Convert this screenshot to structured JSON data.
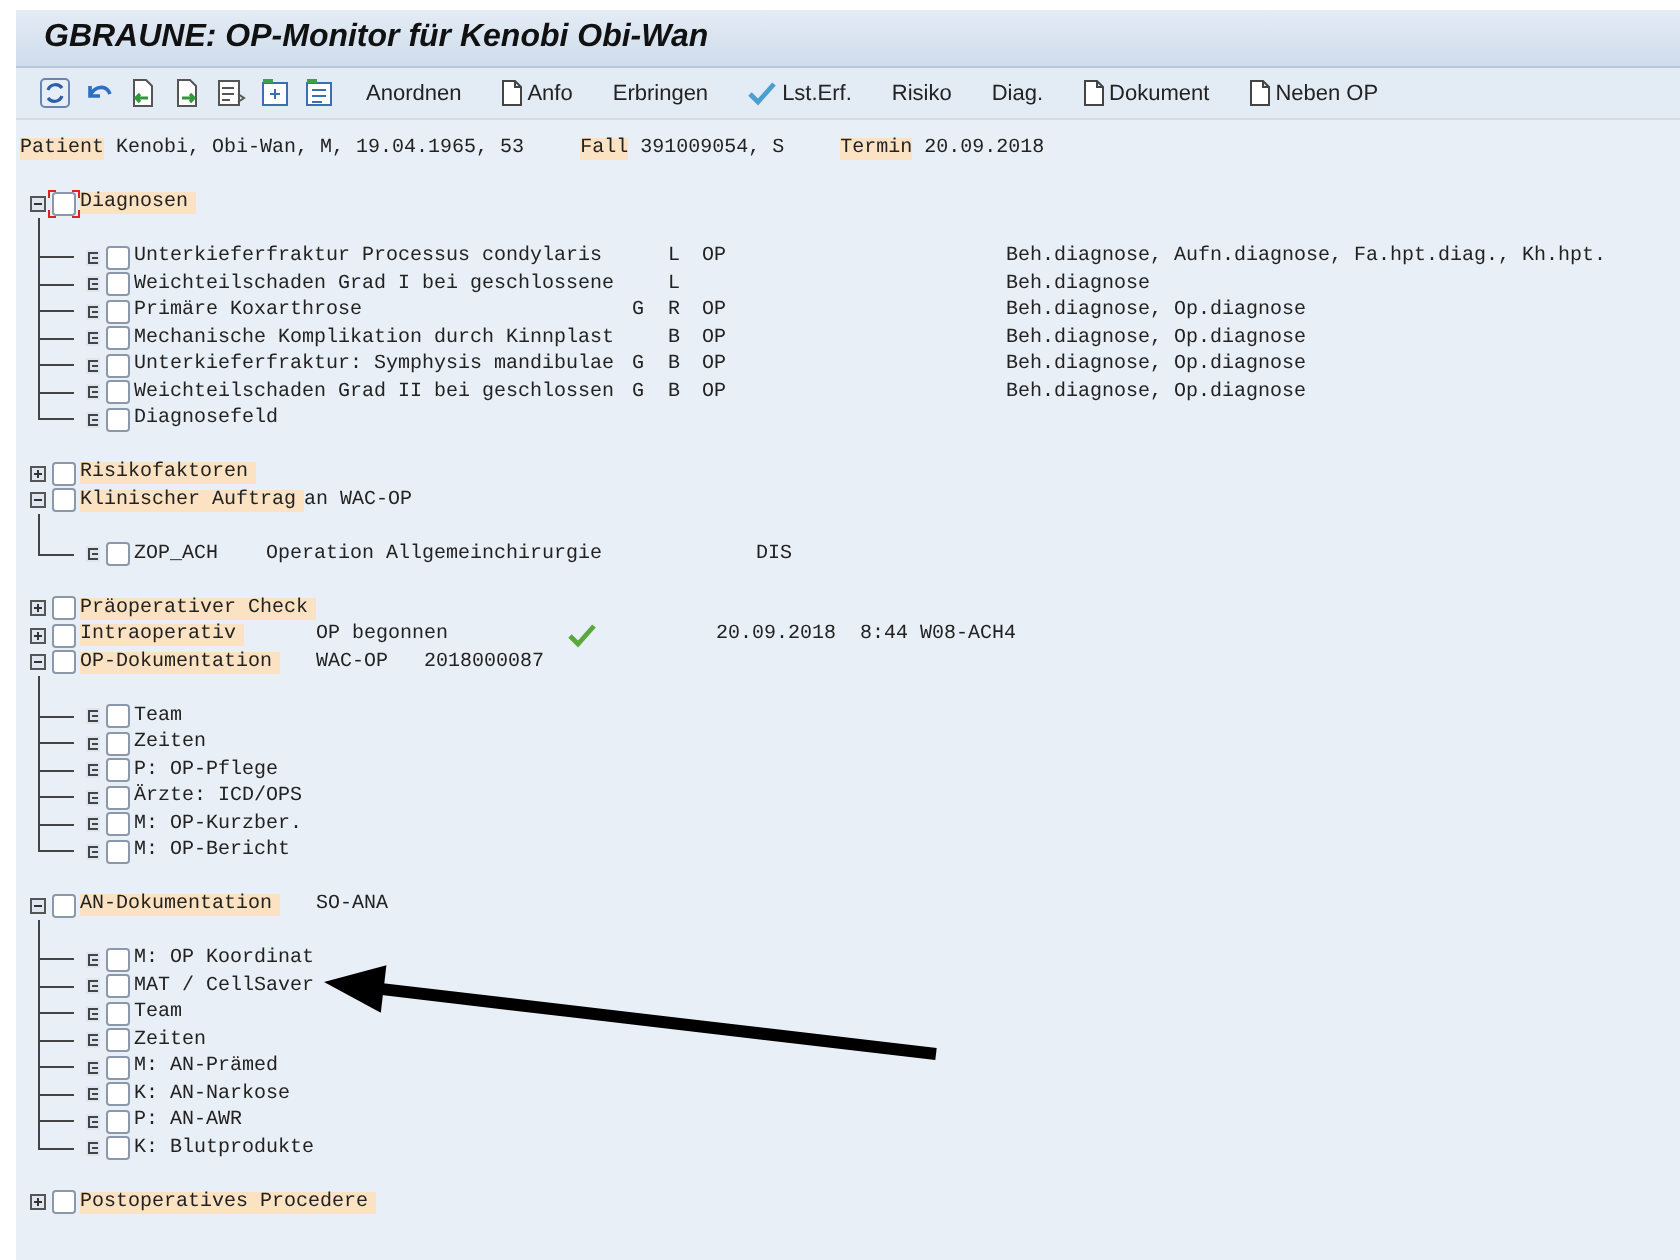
{
  "window": {
    "title": "GBRAUNE: OP-Monitor für Kenobi Obi-Wan"
  },
  "toolbar": [
    {
      "kind": "text",
      "label": "Anordnen"
    },
    {
      "kind": "document",
      "label": "Anfo"
    },
    {
      "kind": "text",
      "label": "Erbringen"
    },
    {
      "kind": "check",
      "label": "Lst.Erf."
    },
    {
      "kind": "text",
      "label": "Risiko"
    },
    {
      "kind": "text",
      "label": "Diag."
    },
    {
      "kind": "document",
      "label": "Dokument"
    },
    {
      "kind": "document",
      "label": "Neben OP"
    }
  ],
  "patient_info": [
    {
      "label": "Patient",
      "value": "Kenobi, Obi-Wan, M, 19.04.1965, 53"
    },
    {
      "label": "Fall",
      "value": "391009054, S"
    },
    {
      "label": "Termin",
      "value": "20.09.2018"
    }
  ],
  "sections": [
    {
      "label": "Diagnosen",
      "expanded": true,
      "checked": false,
      "focused": true,
      "kind": "diagnoses",
      "children": [
        {
          "checked": false,
          "cells": [
            "Unterkieferfraktur Processus condylaris",
            "",
            "L",
            "OP",
            "Beh.diagnose, Aufn.diagnose, Fa.hpt.diag., Kh.hpt."
          ]
        },
        {
          "checked": false,
          "cells": [
            "Weichteilschaden Grad I bei geschlossene",
            "",
            "L",
            "",
            "Beh.diagnose"
          ]
        },
        {
          "checked": false,
          "cells": [
            "Primäre Koxarthrose",
            "G",
            "R",
            "OP",
            "Beh.diagnose, Op.diagnose"
          ]
        },
        {
          "checked": false,
          "cells": [
            "Mechanische Komplikation durch Kinnplast",
            "",
            "B",
            "OP",
            "Beh.diagnose, Op.diagnose"
          ]
        },
        {
          "checked": false,
          "cells": [
            "Unterkieferfraktur: Symphysis mandibulae",
            "G",
            "B",
            "OP",
            "Beh.diagnose, Op.diagnose"
          ]
        },
        {
          "checked": false,
          "cells": [
            "Weichteilschaden Grad II bei geschlossen",
            "G",
            "B",
            "OP",
            "Beh.diagnose, Op.diagnose"
          ]
        },
        {
          "checked": false,
          "cells": [
            "Diagnosefeld"
          ]
        }
      ]
    },
    {
      "label": "Risikofaktoren",
      "expanded": false,
      "checked": false,
      "focused": false,
      "kind": "plain"
    },
    {
      "label": "Klinischer Auftrag",
      "expanded": true,
      "checked": false,
      "focused": false,
      "kind": "order",
      "details": [
        {
          "kind": "suffix",
          "text": "an WAC-OP"
        }
      ],
      "children": [
        {
          "checked": false,
          "cells": [
            "ZOP_ACH",
            "Operation Allgemeinchirurgie",
            "DIS"
          ]
        }
      ]
    },
    {
      "label": "Präoperativer Check",
      "expanded": false,
      "checked": false,
      "focused": false,
      "kind": "plain"
    },
    {
      "label": "Intraoperativ",
      "expanded": false,
      "checked": false,
      "focused": false,
      "kind": "plain",
      "details": [
        {
          "kind": "status",
          "text": "OP begonnen"
        },
        {
          "kind": "check"
        },
        {
          "kind": "date",
          "text": "20.09.2018  8:44 W08-ACH4"
        }
      ]
    },
    {
      "label": "OP-Dokumentation",
      "expanded": true,
      "checked": false,
      "focused": false,
      "kind": "plain",
      "details": [
        {
          "kind": "value",
          "text": "WAC-OP"
        },
        {
          "kind": "value",
          "text": "2018000087"
        }
      ],
      "children": [
        {
          "checked": false,
          "cells": [
            "Team"
          ]
        },
        {
          "checked": false,
          "cells": [
            "Zeiten"
          ]
        },
        {
          "checked": false,
          "cells": [
            "P: OP-Pflege"
          ]
        },
        {
          "checked": false,
          "cells": [
            "Ärzte: ICD/OPS"
          ]
        },
        {
          "checked": false,
          "cells": [
            "M: OP-Kurzber."
          ]
        },
        {
          "checked": false,
          "cells": [
            "M: OP-Bericht"
          ]
        }
      ]
    },
    {
      "label": "AN-Dokumentation",
      "expanded": true,
      "checked": false,
      "focused": false,
      "kind": "plain",
      "details": [
        {
          "kind": "value",
          "text": "SO-ANA"
        }
      ],
      "children": [
        {
          "checked": false,
          "cells": [
            "M: OP Koordinat"
          ]
        },
        {
          "checked": false,
          "cells": [
            "MAT / CellSaver"
          ]
        },
        {
          "checked": false,
          "cells": [
            "Team"
          ]
        },
        {
          "checked": false,
          "cells": [
            "Zeiten"
          ]
        },
        {
          "checked": false,
          "cells": [
            "M: AN-Prämed"
          ]
        },
        {
          "checked": false,
          "cells": [
            "K: AN-Narkose"
          ]
        },
        {
          "checked": false,
          "cells": [
            "P: AN-AWR"
          ]
        },
        {
          "checked": false,
          "cells": [
            "K: Blutprodukte"
          ]
        }
      ]
    },
    {
      "label": "Postoperatives Procedere",
      "expanded": false,
      "checked": false,
      "focused": false,
      "kind": "plain"
    }
  ]
}
